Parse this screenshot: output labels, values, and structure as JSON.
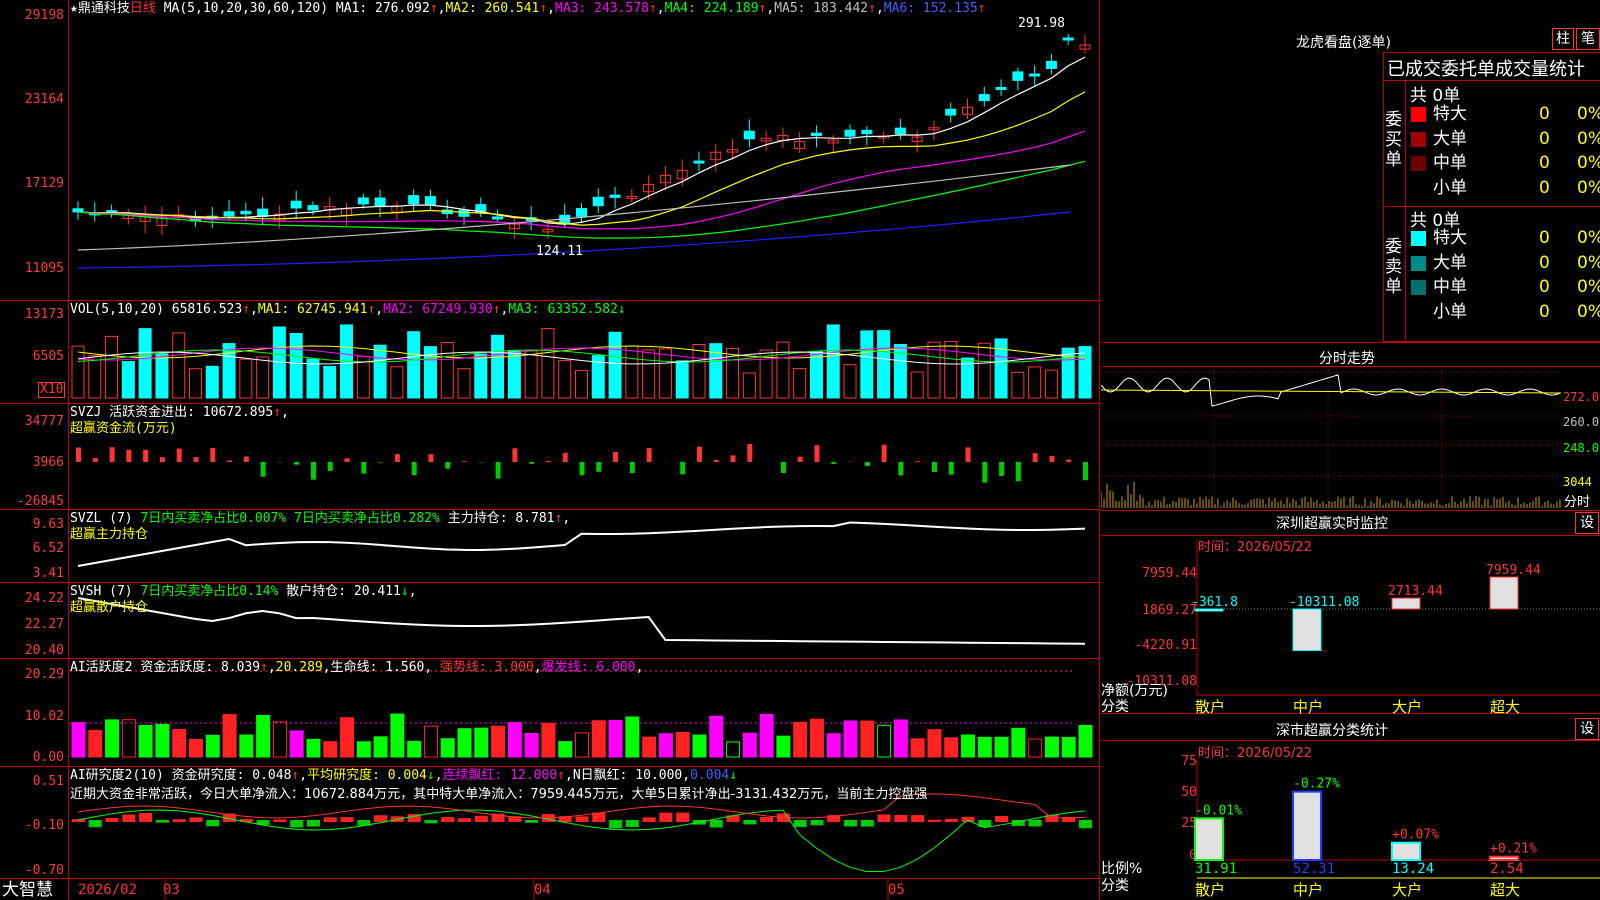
{
  "app": {
    "brand": "大智慧"
  },
  "header": {
    "star": "★",
    "stock_name": "鼎通科技",
    "period": "日线",
    "ma_label": "MA(5,10,20,30,60,120)",
    "ma1": "MA1: 276.092",
    "ma2": "MA2: 260.541",
    "ma3": "MA3: 243.578",
    "ma4": "MA4: 224.189",
    "ma5": "MA5: 183.442",
    "ma6": "MA6: 152.135"
  },
  "kline": {
    "axis": [
      "29198",
      "23164",
      "17129",
      "11095"
    ],
    "high_label": "291.98",
    "low_label": "124.11"
  },
  "volume": {
    "title": "VOL(5,10,20)",
    "value": "65816.523",
    "ma1": "MA1: 62745.941",
    "ma2": "MA2: 67249.930",
    "ma3": "MA3: 63352.582",
    "axis": [
      "13173",
      "6505"
    ],
    "unit": "X10"
  },
  "svzj": {
    "title": "SVZJ  活跃资金进出: 10672.895",
    "sub": "超赢资金流(万元)",
    "axis": [
      "34777",
      "3966",
      "-26845"
    ]
  },
  "svzl": {
    "title": "SVZL (7)",
    "a": "7日内买卖净占比0.007%",
    "b": "7日内买卖净占比0.282%",
    "c": "主力持仓: 8.781",
    "sub": "超赢主力持仓",
    "axis": [
      "9.63",
      "6.52",
      "3.41"
    ]
  },
  "svsh": {
    "title": "SVSH (7)",
    "a": "7日内买卖净占比0.14%",
    "b": "散户持仓: 20.411",
    "sub": "超赢散户持仓",
    "axis": [
      "24.22",
      "22.27",
      "20.40"
    ]
  },
  "ai1": {
    "title": "AI活跃度2",
    "a": "资金活跃度: 8.039",
    "b": "20.289",
    "c": "生命线: 1.560",
    "d": "强势线: 3.000",
    "e": "爆发线: 6.000",
    "axis": [
      "20.29",
      "10.02",
      "0.00"
    ]
  },
  "ai2": {
    "title": "AI研究度2(10)",
    "a": "资金研究度: 0.048",
    "b": "平均研究度: 0.004",
    "c": "连续飘红: 12.000",
    "d": "N日飘红: 10.000",
    "e": "0.004",
    "note": "近期大资金非常活跃，今日大单净流入：10672.884万元，其中特大单净流入：7959.445万元，大单5日累计净出-3131.432万元，当前主力控盘强",
    "axis": [
      "0.51",
      "-0.10",
      "-0.70"
    ]
  },
  "xaxis": {
    "labels": [
      "2026/02",
      "03",
      "04",
      "05"
    ]
  },
  "lhb": {
    "title": "龙虎看盘(逐单)",
    "btn_bar": "柱",
    "btn_stroke": "笔",
    "tabs": "已成交委托单成交量统计",
    "buy_side": "委买单",
    "sell_side": "委卖单",
    "buy_total": "共 0单",
    "sell_total": "共 0单",
    "buy_rows": [
      {
        "label": "特大",
        "n": "0",
        "p": "0%",
        "color": "#ff0000"
      },
      {
        "label": "大单",
        "n": "0",
        "p": "0%",
        "color": "#a00000"
      },
      {
        "label": "中单",
        "n": "0",
        "p": "0%",
        "color": "#700000"
      },
      {
        "label": "小单",
        "n": "0",
        "p": "0%",
        "color": "#000000"
      }
    ],
    "sell_rows": [
      {
        "label": "特大",
        "n": "0",
        "p": "0%",
        "color": "#00ffff"
      },
      {
        "label": "大单",
        "n": "0",
        "p": "0%",
        "color": "#008b8b"
      },
      {
        "label": "中单",
        "n": "0",
        "p": "0%",
        "color": "#007070"
      },
      {
        "label": "小单",
        "n": "0",
        "p": "0%",
        "color": "#000000"
      }
    ]
  },
  "intraday": {
    "title": "分时走势",
    "axis": [
      "272.0",
      "260.0",
      "248.0",
      "3044"
    ],
    "unit": "分时"
  },
  "monitor": {
    "title": "深圳超赢实时监控",
    "btn": "设",
    "date": "时间：2026/05/22",
    "ylabel": "净额(万元)",
    "xlabel": "分类",
    "axis": [
      "7959.44",
      "1869.27",
      "-4220.91",
      "-10311.08"
    ],
    "chart_data": {
      "type": "bar",
      "categories": [
        "散户",
        "中户",
        "大户",
        "超大"
      ],
      "values": [
        -361.8,
        -10311.08,
        2713.44,
        7959.44
      ],
      "labels": [
        "-361.8",
        "-10311.08",
        "2713.44",
        "7959.44"
      ]
    }
  },
  "stats": {
    "title": "深市超赢分类统计",
    "btn": "设",
    "date": "时间：2026/05/22",
    "ylabel": "比例%",
    "xlabel": "分类",
    "axis": [
      "75",
      "50",
      "25",
      "0"
    ],
    "chart_data": {
      "type": "bar",
      "categories": [
        "散户",
        "中户",
        "大户",
        "超大"
      ],
      "values": [
        31.91,
        52.31,
        13.24,
        2.54
      ],
      "changes": [
        "-0.01%",
        "-0.27%",
        "+0.07%",
        "+0.21%"
      ],
      "labels": [
        "31.91",
        "52.31",
        "13.24",
        "2.54"
      ]
    }
  }
}
